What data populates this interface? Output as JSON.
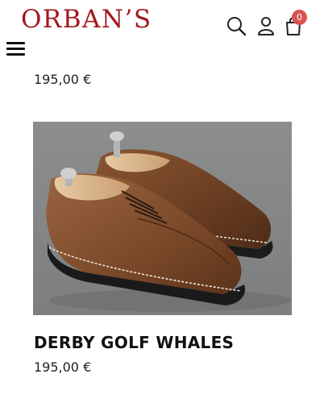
{
  "header": {
    "logo": "ORBAN’S",
    "cart_count": "0",
    "icons": [
      "search-icon",
      "user-icon",
      "bag-icon",
      "menu-icon"
    ],
    "brand_color": "#a3171c",
    "badge_color": "#d9534f"
  },
  "products": [
    {
      "price": "195,00 €"
    },
    {
      "title": "DERBY GOLF WHALES",
      "price": "195,00 €"
    }
  ]
}
